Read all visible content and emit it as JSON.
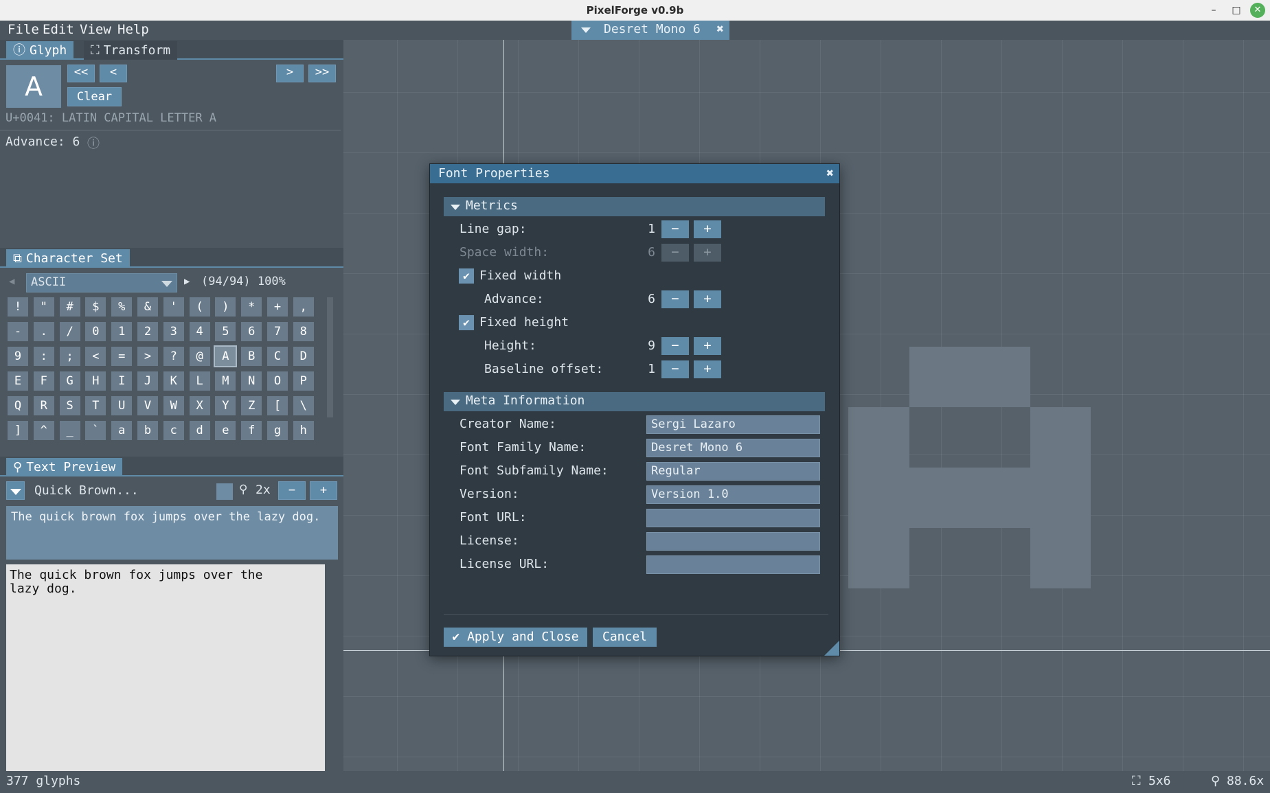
{
  "window": {
    "title": "PixelForge v0.9b"
  },
  "menu": [
    "File",
    "Edit",
    "View",
    "Help"
  ],
  "document_tab": {
    "label": "Desret Mono 6",
    "close": "✖"
  },
  "glyph_panel": {
    "tabs": [
      "Glyph",
      "Transform"
    ],
    "glyph_char": "A",
    "nav": {
      "first": "<<",
      "prev": "<",
      "next": ">",
      "last": ">>"
    },
    "clear_label": "Clear",
    "codepoint_text": "U+0041: LATIN CAPITAL LETTER A",
    "advance_text": "Advance: 6"
  },
  "charset_panel": {
    "tab": "Character Set",
    "selected_set": "ASCII",
    "coverage": "(94/94) 100%",
    "chars": [
      "!",
      "\"",
      "#",
      "$",
      "%",
      "&",
      "'",
      "(",
      ")",
      "*",
      "+",
      ",",
      "-",
      ".",
      "/",
      "0",
      "1",
      "2",
      "3",
      "4",
      "5",
      "6",
      "7",
      "8",
      "9",
      ":",
      ";",
      "<",
      "=",
      ">",
      "?",
      "@",
      "A",
      "B",
      "C",
      "D",
      "E",
      "F",
      "G",
      "H",
      "I",
      "J",
      "K",
      "L",
      "M",
      "N",
      "O",
      "P",
      "Q",
      "R",
      "S",
      "T",
      "U",
      "V",
      "W",
      "X",
      "Y",
      "Z",
      "[",
      "\\",
      "]",
      "^",
      "_",
      "`",
      "a",
      "b",
      "c",
      "d",
      "e",
      "f",
      "g",
      "h"
    ],
    "selected_char": "A"
  },
  "preview_panel": {
    "tab": "Text Preview",
    "preset": "Quick Brown...",
    "zoom": "2x",
    "minus": "−",
    "plus": "+",
    "input_text": "The quick brown fox jumps over the lazy dog.",
    "output_text": "The quick brown fox jumps over the\nlazy dog."
  },
  "status": {
    "glyph_count": "377 glyphs",
    "grid_size": "5x6",
    "zoom": "88.6x"
  },
  "dialog": {
    "title": "Font Properties",
    "close": "✖",
    "metrics_header": "Metrics",
    "line_gap": {
      "label": "Line gap:",
      "value": "1"
    },
    "space_width": {
      "label": "Space width:",
      "value": "6"
    },
    "fixed_width": {
      "label": "Fixed width",
      "checked": true
    },
    "advance": {
      "label": "Advance:",
      "value": "6"
    },
    "fixed_height": {
      "label": "Fixed height",
      "checked": true
    },
    "height": {
      "label": "Height:",
      "value": "9"
    },
    "baseline_offset": {
      "label": "Baseline offset:",
      "value": "1"
    },
    "meta_header": "Meta Information",
    "creator_name": {
      "label": "Creator Name:",
      "value": "Sergi Lazaro"
    },
    "font_family_name": {
      "label": "Font Family Name:",
      "value": "Desret Mono 6"
    },
    "font_subfamily_name": {
      "label": "Font Subfamily Name:",
      "value": "Regular"
    },
    "version": {
      "label": "Version:",
      "value": "Version 1.0"
    },
    "font_url": {
      "label": "Font URL:",
      "value": ""
    },
    "license": {
      "label": "License:",
      "value": ""
    },
    "license_url": {
      "label": "License URL:",
      "value": ""
    },
    "apply_label": "Apply and Close",
    "cancel_label": "Cancel",
    "minus": "−",
    "plus": "+"
  },
  "colors": {
    "accent": "#5f8aa8",
    "dialog_title": "#3a6d92",
    "panel_bg": "#4d5760",
    "canvas_bg": "#56616a"
  }
}
